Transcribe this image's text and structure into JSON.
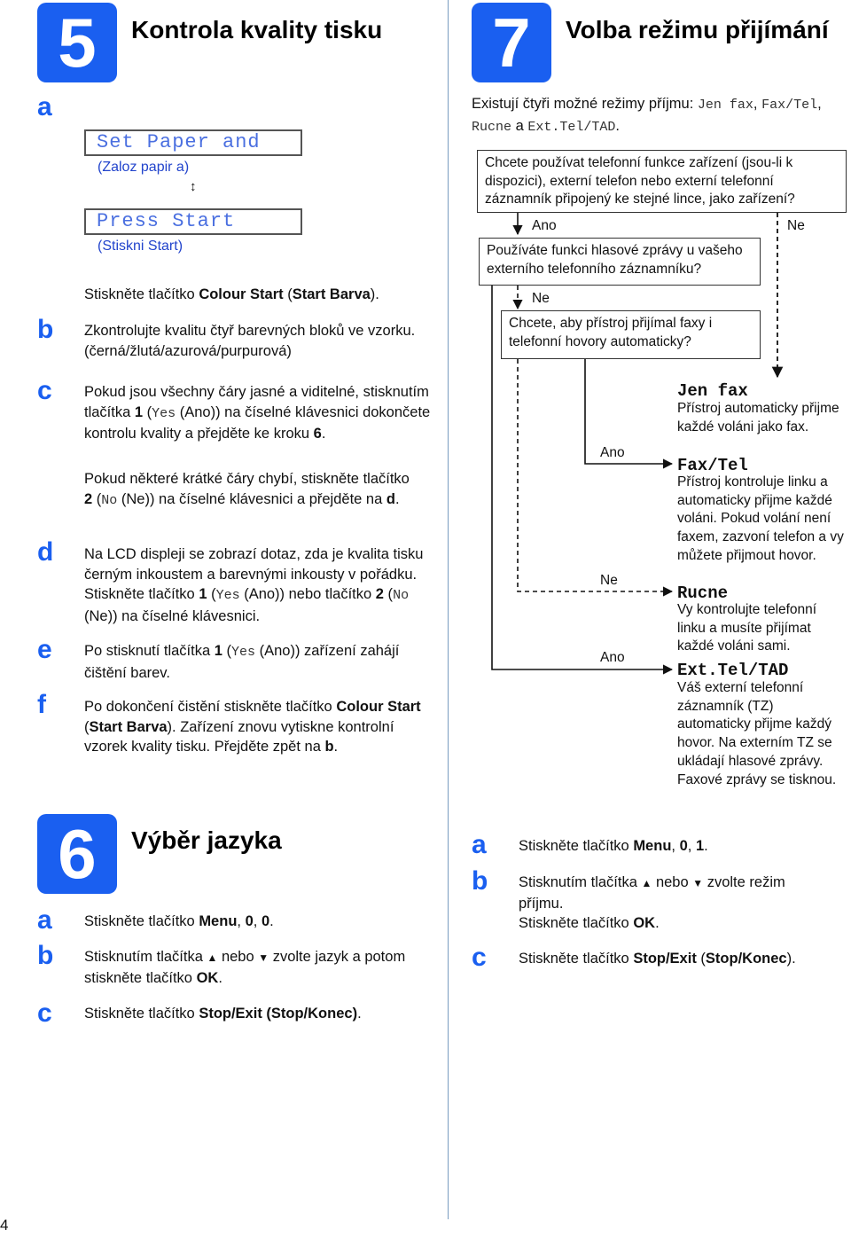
{
  "page_number": "4",
  "accent_color": "#1a5ff0",
  "section5": {
    "number": "5",
    "title": "Kontrola kvality tisku",
    "step_a": {
      "letter": "a",
      "lcd1": "Set Paper and",
      "lcd1_caption": "(Zaloz papir a)",
      "arrow": "↕",
      "lcd2": "Press Start",
      "lcd2_caption": "(Stiskni Start)",
      "text_prefix": "Stiskněte tlačítko ",
      "text_bold1": "Colour Start",
      "text_mid": " (",
      "text_bold2": "Start Barva",
      "text_suffix": ")."
    },
    "step_b": {
      "letter": "b",
      "text": "Zkontrolujte kvalitu čtyř barevných bloků ve vzorku. (černá/žlutá/azurová/purpurová)"
    },
    "step_c": {
      "letter": "c",
      "p1_a": "Pokud jsou všechny čáry jasné a viditelné, stisknutím tlačítka ",
      "p1_key": "1",
      "p1_b": " (",
      "p1_mono": "Yes",
      "p1_c": " (Ano)) na číselné klávesnici dokončete kontrolu kvality a přejděte ke kroku ",
      "p1_ref": "6",
      "p1_end": ".",
      "p2_a": "Pokud některé krátké čáry chybí, stiskněte tlačítko ",
      "p2_key": "2",
      "p2_b": " (",
      "p2_mono": "No",
      "p2_c": " (Ne)) na číselné klávesnici a přejděte na ",
      "p2_ref": "d",
      "p2_end": "."
    },
    "step_d": {
      "letter": "d",
      "a": "Na LCD displeji se zobrazí dotaz, zda je kvalita tisku černým inkoustem a barevnými inkousty v pořádku. Stiskněte tlačítko ",
      "key1": "1",
      "b": " (",
      "mono1": "Yes",
      "c": " (Ano)) nebo tlačítko ",
      "key2": "2",
      "d": " (",
      "mono2": "No",
      "e": " (Ne)) na číselné klávesnici."
    },
    "step_e": {
      "letter": "e",
      "a": "Po stisknutí tlačítka ",
      "key": "1",
      "b": " (",
      "mono": "Yes",
      "c": " (Ano))  zařízení zahájí čištění barev."
    },
    "step_f": {
      "letter": "f",
      "a": "Po dokončení čistění stiskněte tlačítko ",
      "bold1": "Colour Start",
      "b": " (",
      "bold2": "Start Barva",
      "c": "). Zařízení znovu vytiskne kontrolní vzorek kvality tisku. Přejděte zpět na ",
      "ref": "b",
      "d": "."
    }
  },
  "section6": {
    "number": "6",
    "title": "Výběr jazyka",
    "step_a": {
      "letter": "a",
      "a": "Stiskněte tlačítko ",
      "bold": "Menu",
      "b": ", ",
      "k1": "0",
      "c": ", ",
      "k2": "0",
      "d": "."
    },
    "step_b": {
      "letter": "b",
      "a": "Stisknutím tlačítka ",
      "up": "▲",
      "b": " nebo ",
      "down": "▼",
      "c": " zvolte jazyk a potom stiskněte tlačítko ",
      "bold": "OK",
      "d": "."
    },
    "step_c": {
      "letter": "c",
      "a": "Stiskněte tlačítko ",
      "bold": "Stop/Exit (Stop/Konec)",
      "b": "."
    }
  },
  "section7": {
    "number": "7",
    "title": "Volba režimu přijímání",
    "intro_a": "Existují čtyři možné režimy příjmu: ",
    "intro_m1": "Jen fax",
    "intro_b": ", ",
    "intro_m2": "Fax/Tel",
    "intro_c": ", ",
    "intro_m3": "Rucne",
    "intro_d": " a ",
    "intro_m4": "Ext.Tel/TAD",
    "intro_e": ".",
    "flow": {
      "q1": "Chcete používat telefonní funkce zařízení (jsou-li k dispozici), externí telefon nebo externí telefonní záznamník připojený ke stejné lince, jako zařízení?",
      "q1_yes": "Ano",
      "q1_no": "Ne",
      "q2": "Používáte funkci hlasové zprávy u vašeho externího telefonního záznamníku?",
      "q2_no": "Ne",
      "q3": "Chcete, aby přístroj přijímal faxy i telefonní hovory automaticky?",
      "q3_yes": "Ano",
      "q3_no": "Ne",
      "q2_yes": "Ano",
      "modes": [
        {
          "name": "Jen fax",
          "desc": "Přístroj automaticky přijme každé voláni jako fax."
        },
        {
          "name": "Fax/Tel",
          "desc": "Přístroj kontroluje linku a automaticky přijme každé voláni. Pokud volání není faxem, zazvoní telefon a vy můžete přijmout hovor."
        },
        {
          "name": "Rucne",
          "desc": "Vy kontrolujte telefonní linku a musíte přijímat každé voláni sami."
        },
        {
          "name": "Ext.Tel/TAD",
          "desc": "Váš externí telefonní záznamník (TZ) automaticky přijme každý hovor. Na externím TZ se ukládají hlasové zprávy. Faxové zprávy se tisknou."
        }
      ]
    },
    "step_a": {
      "letter": "a",
      "a": "Stiskněte tlačítko ",
      "bold": "Menu",
      "b": ", ",
      "k1": "0",
      "c": ", ",
      "k2": "1",
      "d": "."
    },
    "step_b": {
      "letter": "b",
      "a": "Stisknutím tlačítka ",
      "up": "▲",
      "b": " nebo ",
      "down": "▼",
      "c": " zvolte režim příjmu.",
      "line2a": "Stiskněte tlačítko ",
      "bold": "OK",
      "line2b": "."
    },
    "step_c": {
      "letter": "c",
      "a": "Stiskněte tlačítko ",
      "bold1": "Stop/Exit",
      "b": " (",
      "bold2": "Stop/Konec",
      "c": ")."
    }
  }
}
